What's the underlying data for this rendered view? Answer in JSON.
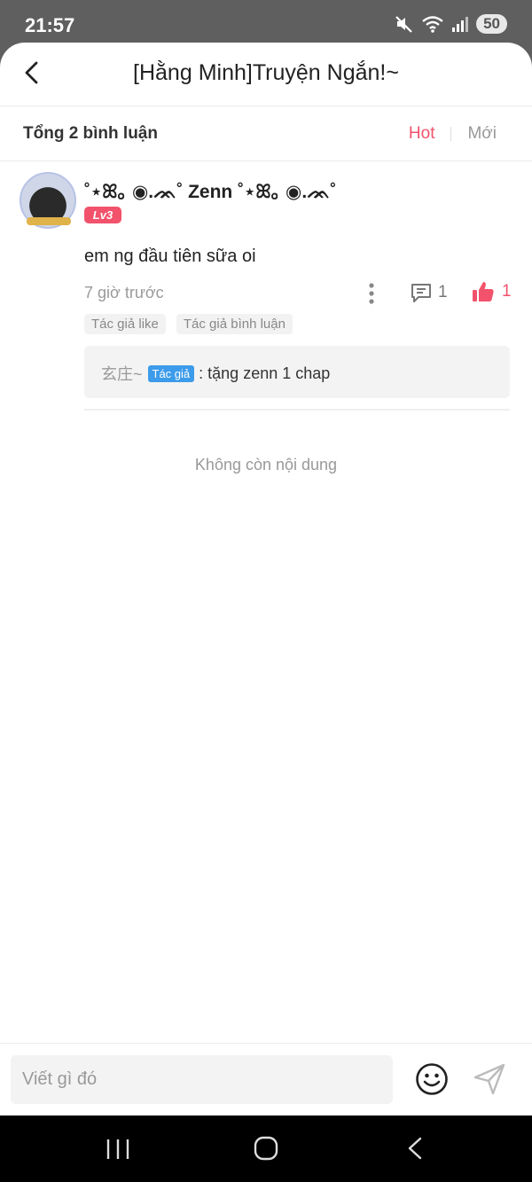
{
  "status_bar": {
    "time": "21:57",
    "battery": "50",
    "icons": [
      "mute-icon",
      "wifi-icon",
      "signal-icon"
    ]
  },
  "header": {
    "title": "[Hằng Minh]Truyện Ngắn!~",
    "back_icon": "chevron-left-icon"
  },
  "comments_header": {
    "total_label": "Tổng 2 bình luận",
    "sort_hot": "Hot",
    "sort_new": "Mới",
    "active_sort": "Hot",
    "accent_color": "#f2526b"
  },
  "comment": {
    "username": "˚⋆ꕤ｡ ◉.ᨏ˚ Zenn ˚⋆ꕤ｡ ◉.ᨏ˚",
    "level": "Lv3",
    "text": "em ng đầu tiên sữa oi",
    "time": "7 giờ trước",
    "reply_count": "1",
    "like_count": "1",
    "liked": true,
    "chips": [
      "Tác giả like",
      "Tác giả bình luận"
    ],
    "reply": {
      "name": "玄庄~",
      "badge": "Tác giả",
      "text": ": tặng zenn 1 chap"
    }
  },
  "end_text": "Không còn nội dung",
  "input": {
    "placeholder": "Viết gì đó",
    "value": ""
  },
  "nav": [
    "recent-apps-icon",
    "home-icon",
    "back-icon"
  ]
}
